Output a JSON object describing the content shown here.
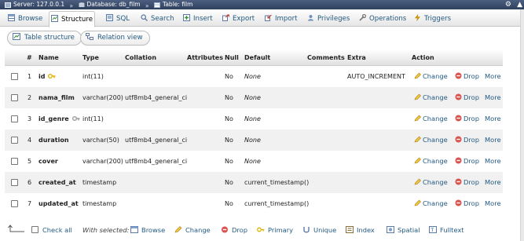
{
  "breadcrumb": {
    "server": "Server: 127.0.0.1",
    "database": "Database: db_film",
    "table": "Table: film",
    "sep": "»"
  },
  "tabs": [
    {
      "label": "Browse",
      "icon": "browse-icon"
    },
    {
      "label": "Structure",
      "icon": "structure-icon",
      "active": true
    },
    {
      "label": "SQL",
      "icon": "sql-icon"
    },
    {
      "label": "Search",
      "icon": "search-icon"
    },
    {
      "label": "Insert",
      "icon": "insert-icon"
    },
    {
      "label": "Export",
      "icon": "export-icon"
    },
    {
      "label": "Import",
      "icon": "import-icon"
    },
    {
      "label": "Privileges",
      "icon": "privileges-icon"
    },
    {
      "label": "Operations",
      "icon": "operations-icon"
    },
    {
      "label": "Triggers",
      "icon": "triggers-icon"
    }
  ],
  "subtabs": [
    {
      "label": "Table structure",
      "icon": "table-structure-icon"
    },
    {
      "label": "Relation view",
      "icon": "relation-view-icon"
    }
  ],
  "columns": [
    "#",
    "Name",
    "Type",
    "Collation",
    "Attributes",
    "Null",
    "Default",
    "Comments",
    "Extra",
    "Action"
  ],
  "rows": [
    {
      "num": "1",
      "name": "id",
      "key": "primary",
      "type": "int(11)",
      "collation": "",
      "attributes": "",
      "null": "No",
      "default": "None",
      "default_italic": true,
      "comments": "",
      "extra": "AUTO_INCREMENT"
    },
    {
      "num": "2",
      "name": "nama_film",
      "key": "",
      "type": "varchar(200)",
      "collation": "utf8mb4_general_ci",
      "attributes": "",
      "null": "No",
      "default": "None",
      "default_italic": true,
      "comments": "",
      "extra": ""
    },
    {
      "num": "3",
      "name": "id_genre",
      "key": "index",
      "type": "int(11)",
      "collation": "",
      "attributes": "",
      "null": "No",
      "default": "None",
      "default_italic": true,
      "comments": "",
      "extra": ""
    },
    {
      "num": "4",
      "name": "duration",
      "key": "",
      "type": "varchar(50)",
      "collation": "utf8mb4_general_ci",
      "attributes": "",
      "null": "No",
      "default": "None",
      "default_italic": true,
      "comments": "",
      "extra": ""
    },
    {
      "num": "5",
      "name": "cover",
      "key": "",
      "type": "varchar(200)",
      "collation": "utf8mb4_general_ci",
      "attributes": "",
      "null": "No",
      "default": "None",
      "default_italic": true,
      "comments": "",
      "extra": ""
    },
    {
      "num": "6",
      "name": "created_at",
      "key": "",
      "type": "timestamp",
      "collation": "",
      "attributes": "",
      "null": "No",
      "default": "current_timestamp()",
      "default_italic": false,
      "comments": "",
      "extra": ""
    },
    {
      "num": "7",
      "name": "updated_at",
      "key": "",
      "type": "timestamp",
      "collation": "",
      "attributes": "",
      "null": "No",
      "default": "current_timestamp()",
      "default_italic": false,
      "comments": "",
      "extra": ""
    }
  ],
  "row_actions": {
    "change": "Change",
    "drop": "Drop",
    "more": "More"
  },
  "footer": {
    "check_all": "Check all",
    "with_selected": "With selected:",
    "actions": [
      {
        "label": "Browse",
        "icon": "browse-icon"
      },
      {
        "label": "Change",
        "icon": "pencil-icon"
      },
      {
        "label": "Drop",
        "icon": "drop-icon"
      },
      {
        "label": "Primary",
        "icon": "primary-key-icon"
      },
      {
        "label": "Unique",
        "icon": "unique-icon"
      },
      {
        "label": "Index",
        "icon": "index-icon"
      },
      {
        "label": "Spatial",
        "icon": "spatial-icon"
      },
      {
        "label": "Fulltext",
        "icon": "fulltext-icon"
      }
    ]
  },
  "colors": {
    "link": "#235a81",
    "topbar": "#3a4c6e",
    "row_alt": "#f1f1f1",
    "drop_red": "#d9534f",
    "key_gold": "#e0b400"
  }
}
